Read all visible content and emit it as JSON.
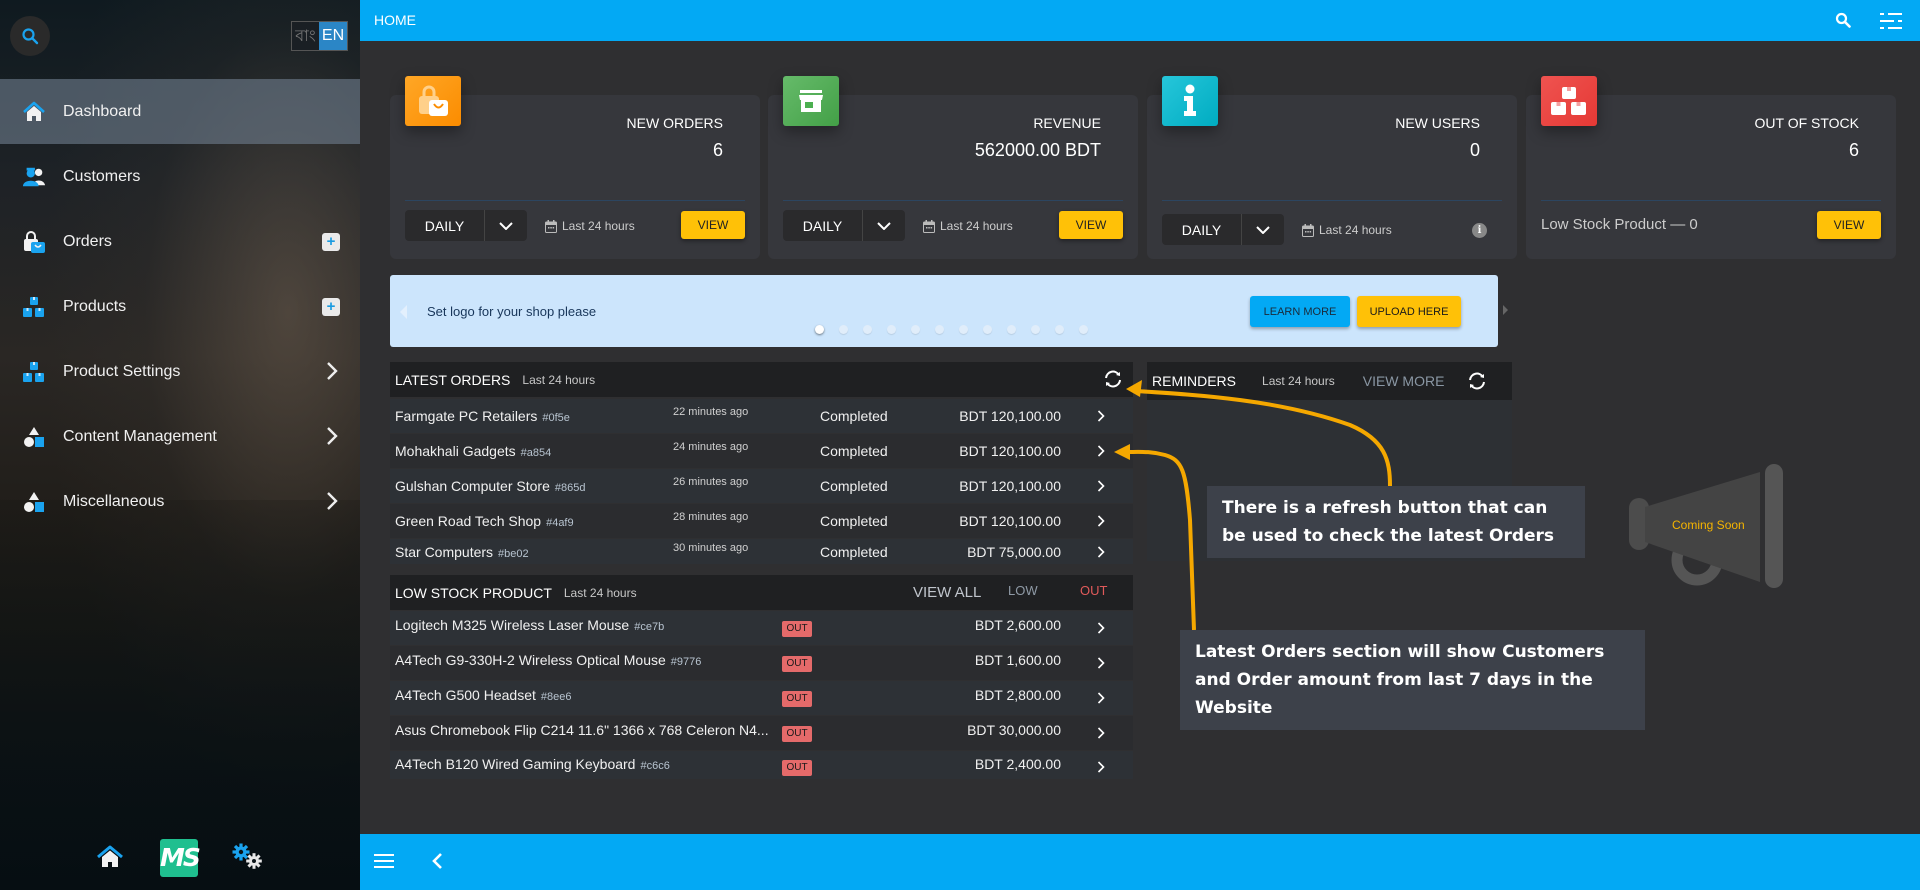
{
  "sidebar": {
    "language": {
      "bangla": "বাং",
      "english": "EN",
      "selected": "EN"
    },
    "items": [
      {
        "label": "Dashboard",
        "icon": "home-icon",
        "active": true,
        "action": "none"
      },
      {
        "label": "Customers",
        "icon": "users-icon",
        "active": false,
        "action": "none"
      },
      {
        "label": "Orders",
        "icon": "shopping-bag-icon",
        "active": false,
        "action": "add"
      },
      {
        "label": "Products",
        "icon": "boxes-icon",
        "active": false,
        "action": "add"
      },
      {
        "label": "Product Settings",
        "icon": "boxes-icon",
        "active": false,
        "action": "expand"
      },
      {
        "label": "Content Management",
        "icon": "shapes-icon",
        "active": false,
        "action": "expand"
      },
      {
        "label": "Miscellaneous",
        "icon": "shapes-icon",
        "active": false,
        "action": "expand"
      }
    ],
    "bottom": {
      "logo_text": "MS"
    }
  },
  "topbar": {
    "title": "HOME"
  },
  "cards": [
    {
      "title": "NEW ORDERS",
      "value": "6",
      "period": "DAILY",
      "range": "Last 24 hours",
      "button": "VIEW",
      "color": "#ff9800",
      "icon": "shopping-bag-icon"
    },
    {
      "title": "REVENUE",
      "value": "562000.00 BDT",
      "period": "DAILY",
      "range": "Last 24 hours",
      "button": "VIEW",
      "color": "#4caf50",
      "icon": "store-icon"
    },
    {
      "title": "NEW USERS",
      "value": "0",
      "period": "DAILY",
      "range": "Last 24 hours",
      "info": "i",
      "color": "#00bcd4",
      "icon": "info-icon"
    },
    {
      "title": "OUT OF STOCK",
      "value": "6",
      "footer_text": "Low Stock Product — 0",
      "button": "VIEW",
      "color": "#e53935",
      "icon": "boxes-icon"
    }
  ],
  "banner": {
    "text": "Set logo for your shop please",
    "learn_more": "LEARN MORE",
    "upload_here": "UPLOAD HERE",
    "slide_count": 12,
    "active_slide": 1
  },
  "latest_orders": {
    "title": "LATEST ORDERS",
    "subtitle": "Last 24 hours",
    "rows": [
      {
        "name": "Farmgate PC Retailers",
        "id": "#0f5e",
        "time": "22 minutes ago",
        "status": "Completed",
        "amount": "BDT 120,100.00"
      },
      {
        "name": "Mohakhali Gadgets",
        "id": "#a854",
        "time": "24 minutes ago",
        "status": "Completed",
        "amount": "BDT 120,100.00"
      },
      {
        "name": "Gulshan Computer Store",
        "id": "#865d",
        "time": "26 minutes ago",
        "status": "Completed",
        "amount": "BDT 120,100.00"
      },
      {
        "name": "Green Road Tech Shop",
        "id": "#4af9",
        "time": "28 minutes ago",
        "status": "Completed",
        "amount": "BDT 120,100.00"
      },
      {
        "name": "Star Computers",
        "id": "#be02",
        "time": "30 minutes ago",
        "status": "Completed",
        "amount": "BDT 75,000.00"
      }
    ]
  },
  "low_stock": {
    "title": "LOW STOCK PRODUCT",
    "subtitle": "Last 24 hours",
    "view_all": "VIEW ALL",
    "filter_low": "LOW",
    "filter_out": "OUT",
    "rows": [
      {
        "name": "Logitech M325 Wireless Laser Mouse",
        "id": "#ce7b",
        "badge": "OUT",
        "amount": "BDT 2,600.00"
      },
      {
        "name": "A4Tech G9-330H-2 Wireless Optical Mouse",
        "id": "#9776",
        "badge": "OUT",
        "amount": "BDT 1,600.00"
      },
      {
        "name": "A4Tech G500 Headset",
        "id": "#8ee6",
        "badge": "OUT",
        "amount": "BDT 2,800.00"
      },
      {
        "name": "Asus Chromebook Flip C214 11.6\" 1366 x 768 Celeron N4...",
        "id": "",
        "badge": "OUT",
        "amount": "BDT 30,000.00"
      },
      {
        "name": "A4Tech B120 Wired Gaming Keyboard",
        "id": "#c6c6",
        "badge": "OUT",
        "amount": "BDT 2,400.00"
      }
    ]
  },
  "reminders": {
    "title": "REMINDERS",
    "subtitle": "Last 24 hours",
    "view_more": "VIEW MORE"
  },
  "coming_soon": "Coming Soon",
  "annotations": {
    "refresh_note": "There is a refresh button that can be used to check the latest Orders",
    "orders_note": "Latest Orders section will show Customers and Order amount from last 7 days in the Website"
  },
  "colors": {
    "accent": "#03a9f4",
    "warning": "#ffc107",
    "annotation_arrow": "#f5a800",
    "out_badge": "#e46a6a"
  }
}
